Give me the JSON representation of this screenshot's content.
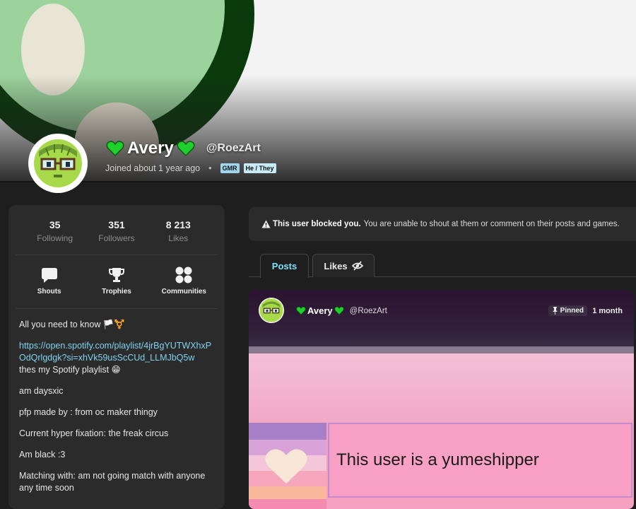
{
  "profile": {
    "name": "Avery",
    "handle": "@RoezArt",
    "joined": "Joined about 1 year ago",
    "badges": [
      "GMR",
      "He / They"
    ]
  },
  "stats": [
    {
      "value": "35",
      "label": "Following"
    },
    {
      "value": "351",
      "label": "Followers"
    },
    {
      "value": "8 213",
      "label": "Likes"
    }
  ],
  "actions": [
    {
      "label": "Shouts",
      "icon": "chat-bubble-icon"
    },
    {
      "label": "Trophies",
      "icon": "trophy-icon"
    },
    {
      "label": "Communities",
      "icon": "communities-icon"
    }
  ],
  "bio": {
    "line1": "All you need to know 🏳️⚧️",
    "link": "https://open.spotify.com/playlist/4jrBgYUTWXhxPOdQrlgdgk?si=xhVk59usScCUd_LLMJbQ5w",
    "line2": "thes my Spotify playlist 😁",
    "line3": "am daysxic",
    "line4": "pfp made by : from oc maker thingy",
    "line5": "Current hyper fixation:  the freak circus",
    "line6": "Am black :3",
    "line7": "Matching with: am not going match with anyone any time soon"
  },
  "notice": {
    "strong": "This user blocked you.",
    "text": "You are unable to shout at them or comment on their posts and games."
  },
  "tabs": {
    "posts": "Posts",
    "likes": "Likes"
  },
  "post": {
    "name": "Avery",
    "handle": "@RoezArt",
    "pinned": "Pinned",
    "time": "1 month",
    "stamp_text": "This user is a yumeshipper"
  },
  "colors": {
    "accent": "#7fe0f5",
    "heart": "#1fcf2c",
    "background": "#1e1e1e",
    "panel": "#2b2b2b"
  }
}
